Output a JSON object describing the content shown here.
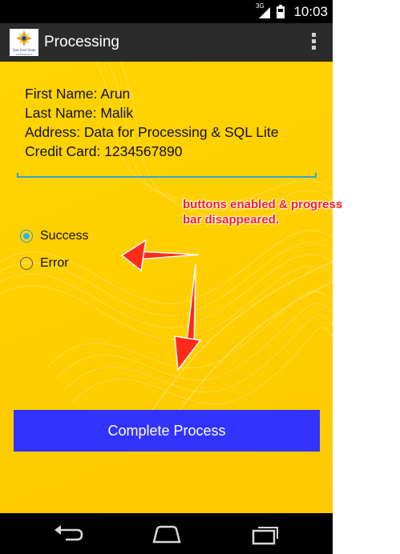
{
  "status_bar": {
    "network_label": "3G",
    "time": "10:03"
  },
  "action_bar": {
    "title": "Processing",
    "logo_text": "San José State UNIVERSITY",
    "overflow_icon": "overflow-menu-icon"
  },
  "details": {
    "first_name": "First Name: Arun",
    "last_name": "Last Name: Malik",
    "address": "Address: Data for Processing & SQL Lite",
    "credit_card": "Credit Card: 1234567890"
  },
  "edit_field": {
    "value": ""
  },
  "radio_group": {
    "options": [
      {
        "label": "Success",
        "checked": true
      },
      {
        "label": "Error",
        "checked": false
      }
    ]
  },
  "complete_button": {
    "label": "Complete Process",
    "color": "#3333ff"
  },
  "annotation": {
    "line1": "buttons enabled & progress",
    "line2": "bar disappeared.",
    "color": "#ff1a1a"
  },
  "nav_bar": {
    "back_icon": "back-icon",
    "home_icon": "home-icon",
    "recents_icon": "recents-icon"
  }
}
